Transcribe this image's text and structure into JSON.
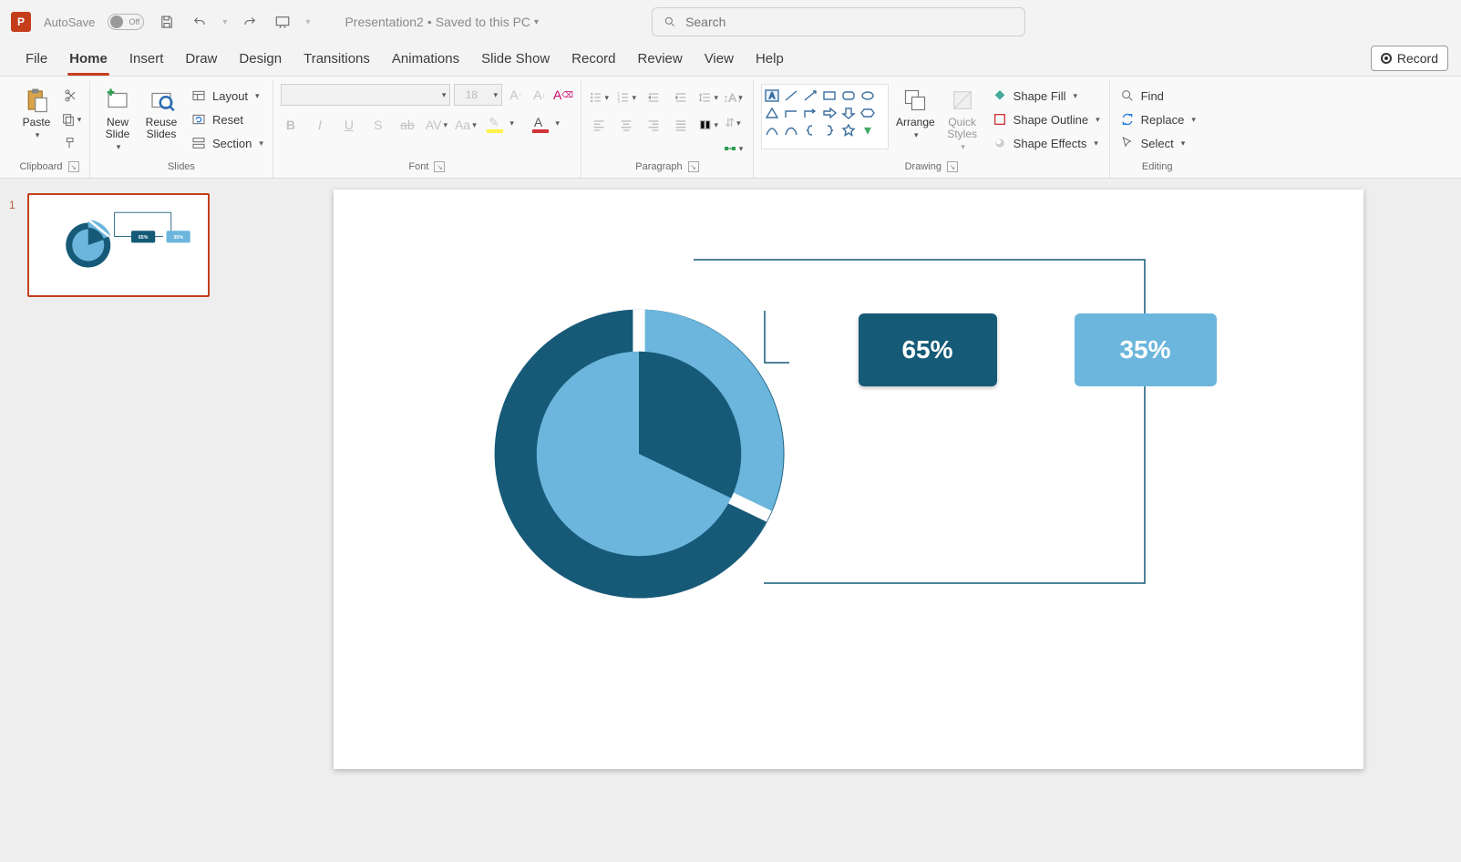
{
  "titlebar": {
    "app_letter": "P",
    "autosave_label": "AutoSave",
    "autosave_state": "Off",
    "doc_name": "Presentation2",
    "doc_status": "Saved to this PC",
    "search_placeholder": "Search"
  },
  "tabs": {
    "items": [
      "File",
      "Home",
      "Insert",
      "Draw",
      "Design",
      "Transitions",
      "Animations",
      "Slide Show",
      "Record",
      "Review",
      "View",
      "Help"
    ],
    "active": "Home",
    "record_button": "Record"
  },
  "ribbon": {
    "clipboard": {
      "paste": "Paste",
      "label": "Clipboard"
    },
    "slides": {
      "new_slide": "New\nSlide",
      "reuse": "Reuse\nSlides",
      "layout": "Layout",
      "reset": "Reset",
      "section": "Section",
      "label": "Slides"
    },
    "font": {
      "size": "18",
      "label": "Font"
    },
    "paragraph": {
      "label": "Paragraph"
    },
    "drawing": {
      "arrange": "Arrange",
      "quick_styles": "Quick\nStyles",
      "shape_fill": "Shape Fill",
      "shape_outline": "Shape Outline",
      "shape_effects": "Shape Effects",
      "label": "Drawing"
    },
    "editing": {
      "find": "Find",
      "replace": "Replace",
      "select": "Select",
      "label": "Editing"
    }
  },
  "thumbs": {
    "slide_number": "1"
  },
  "chart_data": {
    "type": "pie",
    "series": [
      {
        "name": "Dark segment",
        "value": 65,
        "label": "65%",
        "color": "#155a77"
      },
      {
        "name": "Light segment",
        "value": 35,
        "label": "35%",
        "color": "#6cb6dd"
      }
    ],
    "title": ""
  }
}
